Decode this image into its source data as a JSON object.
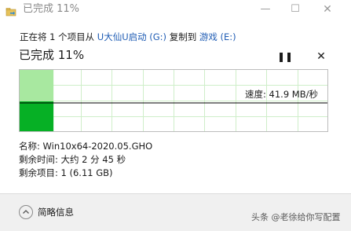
{
  "window": {
    "title": "已完成 11%",
    "minimize_glyph": "—",
    "maximize_glyph": "☐",
    "close_glyph": "✕"
  },
  "copy": {
    "prefix": "正在将 1 个项目从 ",
    "source": "U大仙U启动 (G:)",
    "middle": " 复制到 ",
    "destination": "游戏 (E:)"
  },
  "progress": {
    "label": "已完成 11%",
    "percent": 11,
    "pause_glyph": "❚❚",
    "cancel_glyph": "✕"
  },
  "speed": {
    "label": "速度: 41.9 MB/秒"
  },
  "details": {
    "name": "名称: Win10x64-2020.05.GHO",
    "time_remaining": "剩余时间: 大约 2 分 45 秒",
    "items_remaining": "剩余项目: 1 (6.11 GB)"
  },
  "footer": {
    "label": "简略信息",
    "watermark": "头条 @老徐给你写配置"
  },
  "colors": {
    "accent_link": "#1f5cb4",
    "progress_fill": "#06b025",
    "progress_fill_light": "#a8e8a0",
    "grid_line": "#cfeec9"
  }
}
